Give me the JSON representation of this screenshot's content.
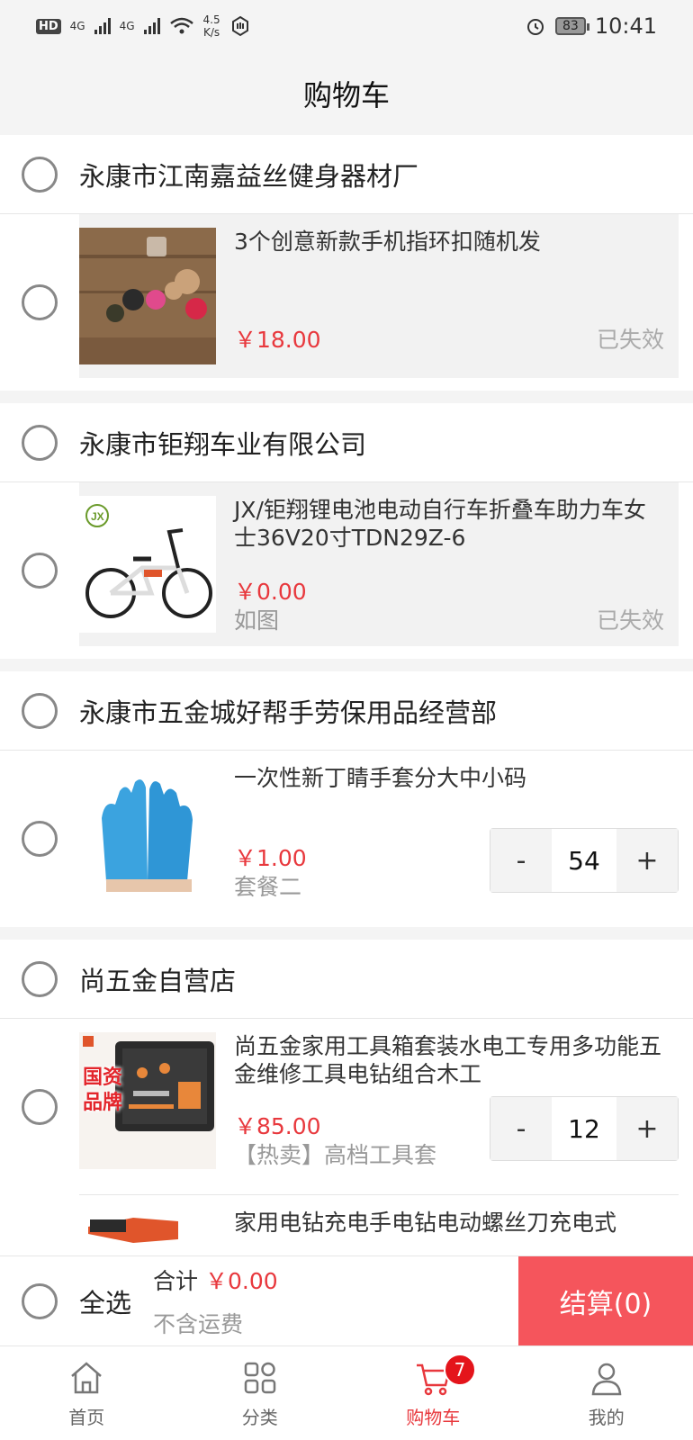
{
  "status_bar": {
    "hd": "HD",
    "net1": "4G",
    "net2": "4G",
    "speed_value": "4.5",
    "speed_unit": "K/s",
    "battery": "83",
    "time": "10:41"
  },
  "header": {
    "title": "购物车"
  },
  "shops": [
    {
      "name": "永康市江南嘉益丝健身器材厂",
      "items": [
        {
          "title": "3个创意新款手机指环扣随机发",
          "price": "￥18.00",
          "spec": "",
          "status": "已失效"
        }
      ]
    },
    {
      "name": "永康市钜翔车业有限公司",
      "items": [
        {
          "title": "JX/钜翔锂电池电动自行车折叠车助力车女士36V20寸TDN29Z-6",
          "price": "￥0.00",
          "spec": "如图",
          "status": "已失效"
        }
      ]
    },
    {
      "name": "永康市五金城好帮手劳保用品经营部",
      "items": [
        {
          "title": "一次性新丁睛手套分大中小码",
          "price": "￥1.00",
          "spec": "套餐二",
          "quantity": "54"
        }
      ]
    },
    {
      "name": "尚五金自营店",
      "items": [
        {
          "title": "尚五金家用工具箱套装水电工专用多功能五金维修工具电钻组合木工",
          "price": "￥85.00",
          "spec": "【热卖】高档工具套",
          "quantity": "12",
          "thumb_text": "国资品牌"
        },
        {
          "title": "家用电钻充电手电钻电动螺丝刀充电式"
        }
      ]
    }
  ],
  "stepper": {
    "minus": "-",
    "plus": "+"
  },
  "checkout": {
    "select_all": "全选",
    "total_label": "合计",
    "total_amount": "￥0.00",
    "shipping_note": "不含运费",
    "button": "结算(0)"
  },
  "tabbar": {
    "home": "首页",
    "category": "分类",
    "cart": "购物车",
    "cart_badge": "7",
    "me": "我的"
  },
  "colors": {
    "accent": "#e8383d",
    "checkout_button": "#f5555c",
    "badge": "#e4141b"
  }
}
